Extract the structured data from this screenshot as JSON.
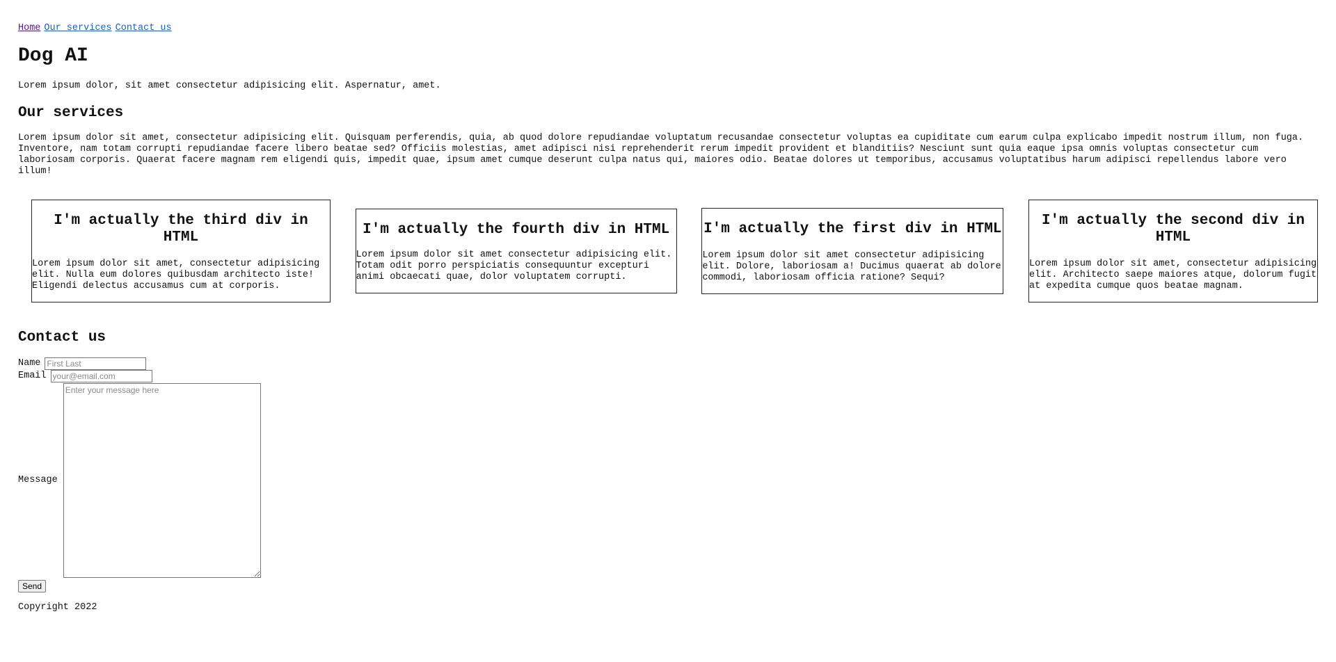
{
  "nav": {
    "home": "Home",
    "services": "Our services",
    "contact": "Contact us"
  },
  "title": "Dog AI",
  "intro": "Lorem ipsum dolor, sit amet consectetur adipisicing elit. Aspernatur, amet.",
  "services": {
    "heading": "Our services",
    "text": "Lorem ipsum dolor sit amet, consectetur adipisicing elit. Quisquam perferendis, quia, ab quod dolore repudiandae voluptatum recusandae consectetur voluptas ea cupiditate cum earum culpa explicabo impedit nostrum illum, non fuga. Inventore, nam totam corrupti repudiandae facere libero beatae sed? Officiis molestias, amet adipisci nisi reprehenderit rerum impedit provident et blanditiis? Nesciunt sunt quia eaque ipsa omnis voluptas consectetur cum laboriosam corporis. Quaerat facere magnam rem eligendi quis, impedit quae, ipsum amet cumque deserunt culpa natus qui, maiores odio. Beatae dolores ut temporibus, accusamus voluptatibus harum adipisci repellendus labore vero illum!"
  },
  "cards": [
    {
      "heading": "I'm actually the third div in HTML",
      "text": "Lorem ipsum dolor sit amet, consectetur adipisicing elit. Nulla eum dolores quibusdam architecto iste! Eligendi delectus accusamus cum at corporis."
    },
    {
      "heading": "I'm actually the fourth div in HTML",
      "text": "Lorem ipsum dolor sit amet consectetur adipisicing elit. Totam odit porro perspiciatis consequuntur excepturi animi obcaecati quae, dolor voluptatem corrupti."
    },
    {
      "heading": "I'm actually the first div in HTML",
      "text": "Lorem ipsum dolor sit amet consectetur adipisicing elit. Dolore, laboriosam a! Ducimus quaerat ab dolore commodi, laboriosam officia ratione? Sequi?"
    },
    {
      "heading": "I'm actually the second div in HTML",
      "text": "Lorem ipsum dolor sit amet, consectetur adipisicing elit. Architecto saepe maiores atque, dolorum fugit at expedita cumque quos beatae magnam."
    }
  ],
  "contact": {
    "heading": "Contact us",
    "name_label": "Name",
    "name_placeholder": "First Last",
    "email_label": "Email",
    "email_placeholder": "your@email.com",
    "message_label": "Message",
    "message_placeholder": "Enter your message here",
    "send_label": "Send"
  },
  "footer": "Copyright 2022",
  "colors": {
    "visited_link": "#551a8b",
    "link": "#1a5fc7"
  }
}
